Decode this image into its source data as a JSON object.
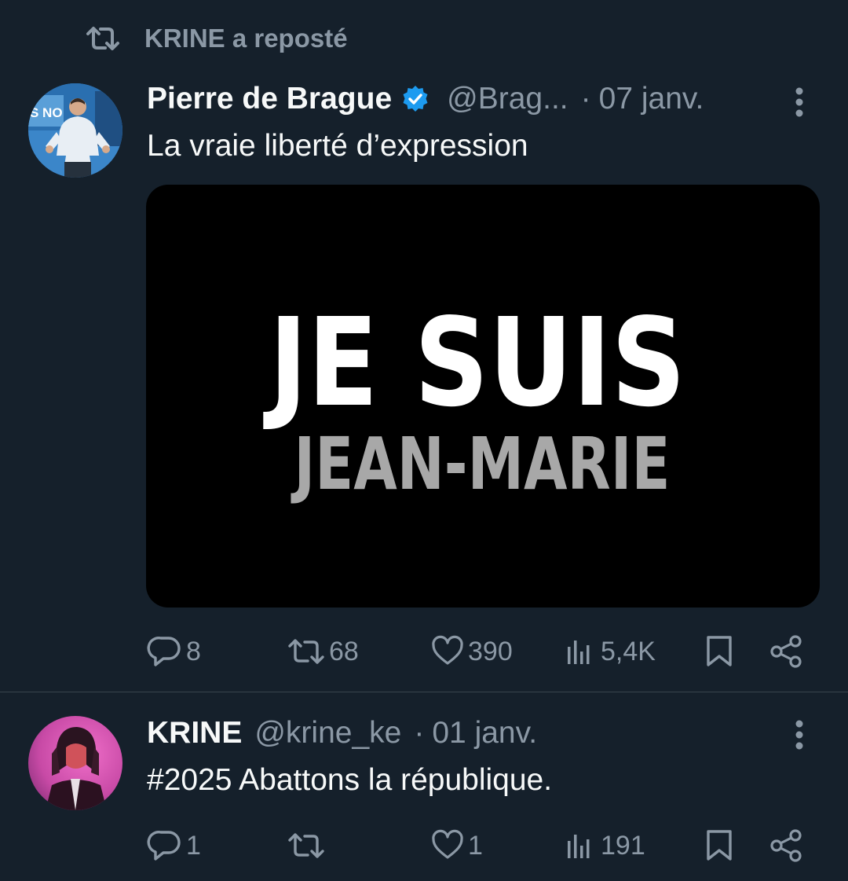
{
  "repost_banner": {
    "text": "KRINE a reposté",
    "icon": "repost-icon"
  },
  "tweets": [
    {
      "author": {
        "name": "Pierre de Brague",
        "verified": true,
        "handle": "@Brag...",
        "date": "07 janv."
      },
      "text": "La vraie liberté d’expression",
      "media": {
        "line1": "JE SUIS",
        "line2": "JEAN-MARIE",
        "avatar_sign_text": "S NO"
      },
      "stats": {
        "replies": "8",
        "reposts": "68",
        "likes": "390",
        "views": "5,4K"
      }
    },
    {
      "author": {
        "name": "KRINE",
        "verified": false,
        "handle": "@krine_ke",
        "date": "01 janv."
      },
      "text": "#2025 Abattons la république.",
      "stats": {
        "replies": "1",
        "reposts": "",
        "likes": "1",
        "views": "191"
      }
    }
  ],
  "separator": "·",
  "colors": {
    "background": "#15202b",
    "text_primary": "#f7f9f9",
    "text_secondary": "#8b98a5",
    "verified_blue": "#1d9bf0",
    "divider": "#38444d",
    "media_background": "#000000"
  }
}
